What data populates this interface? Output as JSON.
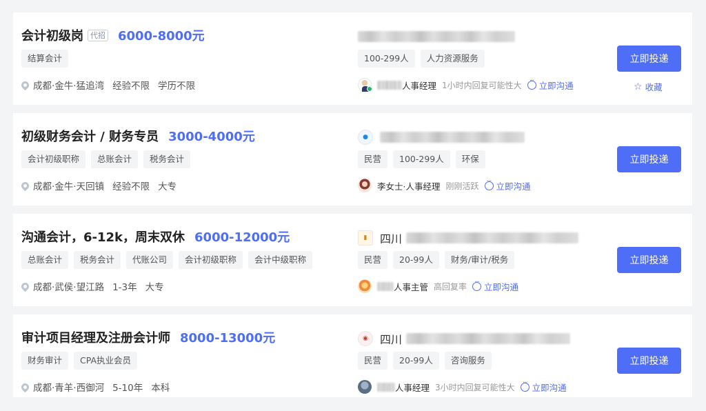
{
  "jobs": [
    {
      "title": "会计初级岗",
      "agency_badge": "代招",
      "salary": "6000-8000元",
      "tags": [
        "结算会计"
      ],
      "location": "成都·金牛·猛追湾",
      "experience": "经验不限",
      "education": "学历不限",
      "company_name": "",
      "company_tags": [
        "100-299人",
        "人力资源服务"
      ],
      "recruiter_name": "人事经理",
      "recruiter_status": "1小时内回复可能性大",
      "chat_label": "立即沟通",
      "apply_label": "立即投递",
      "favorite_label": "收藏"
    },
    {
      "title": "初级财务会计 / 财务专员",
      "salary": "3000-4000元",
      "tags": [
        "会计初级职称",
        "总账会计",
        "税务会计"
      ],
      "location": "成都·金牛·天回镇",
      "experience": "经验不限",
      "education": "大专",
      "company_name": "",
      "company_tags": [
        "民营",
        "100-299人",
        "环保"
      ],
      "recruiter_name": "李女士·人事经理",
      "recruiter_status": "刚刚活跃",
      "chat_label": "立即沟通",
      "apply_label": "立即投递"
    },
    {
      "title": "沟通会计，6-12k，周末双休",
      "salary": "6000-12000元",
      "tags": [
        "总账会计",
        "税务会计",
        "代账公司",
        "会计初级职称",
        "会计中级职称"
      ],
      "location": "成都·武侯·望江路",
      "experience": "1-3年",
      "education": "大专",
      "company_name": "四川",
      "company_tags": [
        "民营",
        "20-99人",
        "财务/审计/税务"
      ],
      "recruiter_name": "人事主管",
      "recruiter_status": "高回复率",
      "chat_label": "立即沟通",
      "apply_label": "立即投递"
    },
    {
      "title": "审计项目经理及注册会计师",
      "salary": "8000-13000元",
      "tags": [
        "财务审计",
        "CPA执业会员"
      ],
      "location": "成都·青羊·西御河",
      "experience": "5-10年",
      "education": "本科",
      "company_name": "四川",
      "company_tags": [
        "民营",
        "20-99人",
        "咨询服务"
      ],
      "recruiter_name": "人事经理",
      "recruiter_status": "3小时内回复可能性大",
      "chat_label": "立即沟通",
      "apply_label": "立即投递"
    }
  ],
  "colors": {
    "accent": "#4f6ef7",
    "online": "#1fb86b",
    "tag_bg": "#f3f4f6"
  },
  "icons": [
    "location-pin-icon",
    "chat-bubble-icon",
    "star-outline-icon"
  ]
}
